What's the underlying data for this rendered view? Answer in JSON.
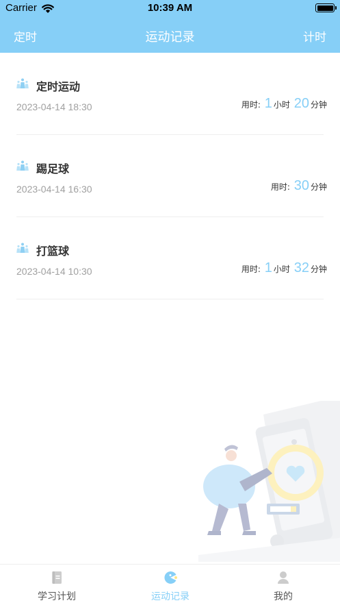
{
  "status_bar": {
    "carrier": "Carrier",
    "time": "10:39 AM"
  },
  "nav": {
    "left": "定时",
    "title": "运动记录",
    "right": "计时"
  },
  "records": [
    {
      "title": "定时运动",
      "date": "2023-04-14 18:30",
      "duration_label": "用时:",
      "hours": "1",
      "hour_unit": "小时",
      "minutes": "20",
      "minute_unit": "分钟"
    },
    {
      "title": "踢足球",
      "date": "2023-04-14 16:30",
      "duration_label": "用时:",
      "minutes": "30",
      "minute_unit": "分钟"
    },
    {
      "title": "打篮球",
      "date": "2023-04-14 10:30",
      "duration_label": "用时:",
      "hours": "1",
      "hour_unit": "小时",
      "minutes": "32",
      "minute_unit": "分钟"
    }
  ],
  "tabs": [
    {
      "label": "学习计划",
      "icon": "book-icon",
      "active": false
    },
    {
      "label": "运动记录",
      "icon": "pie-chart-icon",
      "active": true
    },
    {
      "label": "我的",
      "icon": "user-icon",
      "active": false
    }
  ],
  "colors": {
    "accent": "#86cff7",
    "text": "#333333",
    "muted": "#a0a0a0"
  }
}
